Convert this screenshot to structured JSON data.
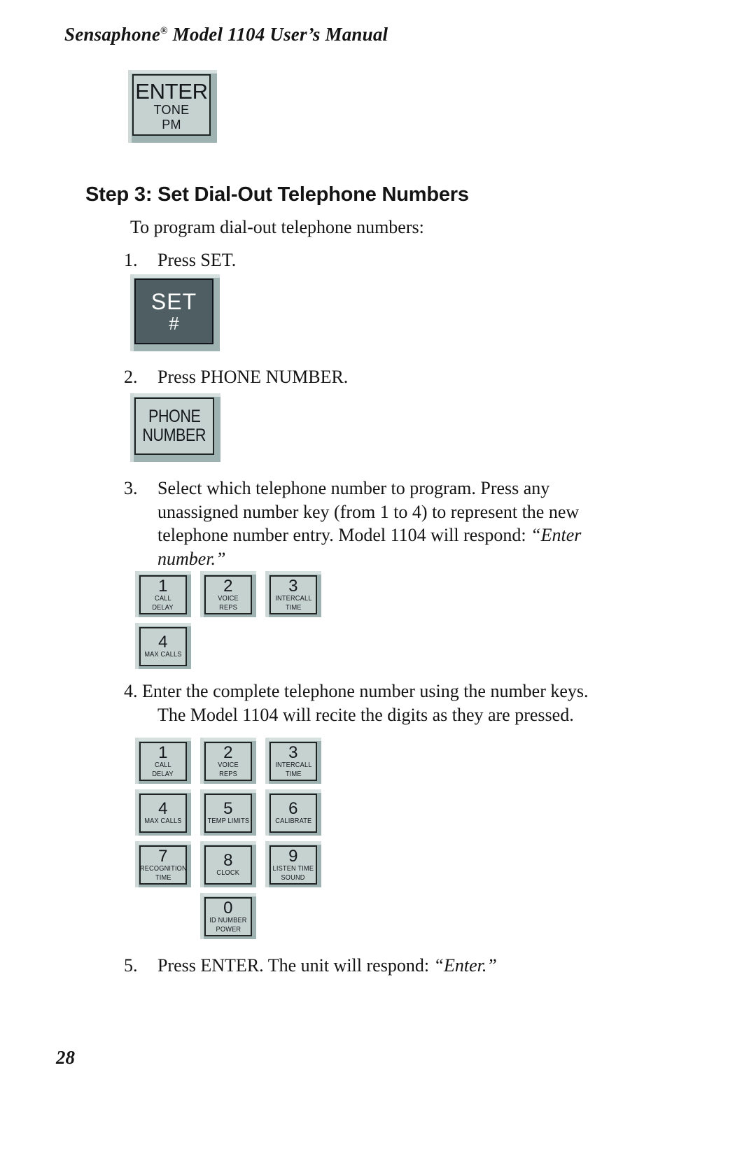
{
  "header": {
    "title_prefix": "Sensaphone",
    "registered_mark": "®",
    "title_suffix": " Model 1104 User’s Manual"
  },
  "top_key": {
    "line1": "ENTER",
    "line2": "TONE",
    "line3": "PM",
    "face_color": "#c6d2d0",
    "text_color": "#14181a"
  },
  "step": {
    "heading": "Step 3:  Set Dial-Out Telephone Numbers",
    "intro": "To program dial-out telephone numbers:"
  },
  "steps": [
    {
      "marker": "1.",
      "text": "Press SET."
    },
    {
      "marker": "2.",
      "text": "Press PHONE NUMBER."
    },
    {
      "marker": "3.",
      "text_part1": "Select which telephone number to program. Press any unassigned number key (from 1 to 4) to represent the new telephone number entry. Model 1104 will respond: ",
      "text_italic": "“Enter number.”"
    },
    {
      "marker": "4.",
      "text_line1": "Enter the complete telephone number using the number keys.",
      "text_line2": "The Model 1104 will recite the digits as they are pressed."
    },
    {
      "marker": "5.",
      "text_part1": "Press ENTER. The unit will respond: ",
      "text_italic": "“Enter.”"
    }
  ],
  "set_key": {
    "line1": "SET",
    "line2": "#",
    "face_color": "#4f5e62",
    "text_color": "#ffffff"
  },
  "phone_key": {
    "line1": "PHONE",
    "line2": "NUMBER",
    "face_color": "#c6d2d0"
  },
  "keypad_partial": {
    "rows": [
      [
        {
          "digit": "1",
          "sub1": "CALL",
          "sub2": "DELAY"
        },
        {
          "digit": "2",
          "sub1": "VOICE",
          "sub2": "REPS"
        },
        {
          "digit": "3",
          "sub1": "INTERCALL",
          "sub2": "TIME"
        }
      ],
      [
        {
          "digit": "4",
          "sub1": "MAX CALLS",
          "sub2": ""
        }
      ]
    ]
  },
  "keypad_full": {
    "rows": [
      [
        {
          "digit": "1",
          "sub1": "CALL",
          "sub2": "DELAY"
        },
        {
          "digit": "2",
          "sub1": "VOICE",
          "sub2": "REPS"
        },
        {
          "digit": "3",
          "sub1": "INTERCALL",
          "sub2": "TIME"
        }
      ],
      [
        {
          "digit": "4",
          "sub1": "MAX CALLS",
          "sub2": ""
        },
        {
          "digit": "5",
          "sub1": "TEMP LIMITS",
          "sub2": ""
        },
        {
          "digit": "6",
          "sub1": "CALIBRATE",
          "sub2": ""
        }
      ],
      [
        {
          "digit": "7",
          "sub1": "RECOGNITION",
          "sub2": "TIME"
        },
        {
          "digit": "8",
          "sub1": "CLOCK",
          "sub2": ""
        },
        {
          "digit": "9",
          "sub1": "LISTEN TIME",
          "sub2": "SOUND"
        }
      ],
      [
        {
          "digit": "0",
          "sub1": "ID NUMBER",
          "sub2": "POWER"
        }
      ]
    ]
  },
  "footer": {
    "page_number": "28"
  }
}
